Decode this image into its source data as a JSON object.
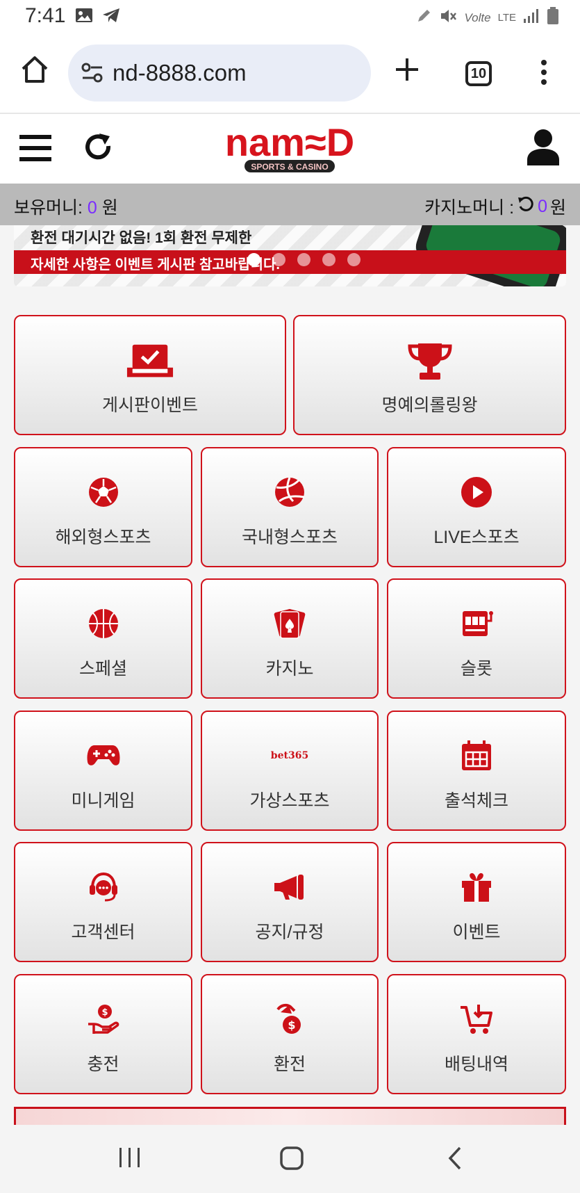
{
  "status_bar": {
    "time": "7:41",
    "icons": [
      "gallery-icon",
      "telegram-icon",
      "pencil-icon",
      "mute-icon",
      "volte-icon",
      "lte-icon",
      "signal-icon",
      "battery-icon"
    ],
    "volte_label": "Volte",
    "lte_label": "LTE"
  },
  "browser": {
    "url": "nd-8888.com",
    "tab_count": "10"
  },
  "site": {
    "logo_text": "nam≈D",
    "logo_subtitle": "SPORTS & CASINO",
    "brand_color": "#d0121b"
  },
  "money_bar": {
    "holding_label": "보유머니:",
    "holding_value": "0",
    "holding_unit": "원",
    "casino_label": "카지노머니 :",
    "casino_value": "0",
    "casino_unit": "원"
  },
  "banner": {
    "line1": "환전 대기시간 없음! 1회 환전 무제한",
    "line2": "자세한 사항은 이벤트 게시판 참고바랍니다.",
    "slide_count": 5,
    "active_slide": 0
  },
  "menu": [
    {
      "label": "게시판이벤트",
      "icon": "board-check-icon"
    },
    {
      "label": "명예의롤링왕",
      "icon": "trophy-icon"
    },
    {
      "label": "해외형스포츠",
      "icon": "soccer-ball-icon"
    },
    {
      "label": "국내형스포츠",
      "icon": "volleyball-icon"
    },
    {
      "label": "LIVE스포츠",
      "icon": "play-icon"
    },
    {
      "label": "스페셜",
      "icon": "basketball-icon"
    },
    {
      "label": "카지노",
      "icon": "playing-cards-icon"
    },
    {
      "label": "슬롯",
      "icon": "slot-machine-icon"
    },
    {
      "label": "미니게임",
      "icon": "gamepad-icon"
    },
    {
      "label": "가상스포츠",
      "icon": "bet365-logo-icon",
      "icon_text": "bet365"
    },
    {
      "label": "출석체크",
      "icon": "calendar-icon"
    },
    {
      "label": "고객센터",
      "icon": "headset-icon"
    },
    {
      "label": "공지/규정",
      "icon": "megaphone-icon"
    },
    {
      "label": "이벤트",
      "icon": "gift-icon"
    },
    {
      "label": "충전",
      "icon": "hand-coin-icon"
    },
    {
      "label": "환전",
      "icon": "coin-exchange-icon"
    },
    {
      "label": "배팅내역",
      "icon": "cart-download-icon"
    }
  ]
}
